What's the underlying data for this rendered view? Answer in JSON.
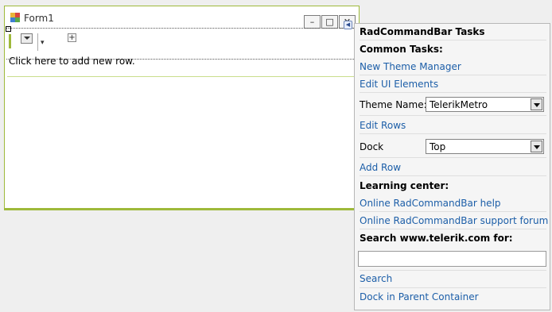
{
  "form": {
    "title": "Form1",
    "add_row_text": "Click here to add new row.",
    "overflow_glyph": "▾",
    "add_glyph": "+",
    "window_buttons": {
      "minimize": "–",
      "maximize": "□",
      "close": "✕"
    }
  },
  "smart_tag_glyph": "◀",
  "tasks_panel": {
    "title": "RadCommandBar Tasks",
    "common_tasks_label": "Common Tasks:",
    "links": {
      "new_theme_manager": "New Theme Manager",
      "edit_ui_elements": "Edit UI Elements",
      "edit_rows": "Edit Rows",
      "add_row": "Add Row"
    },
    "theme_name": {
      "label": "Theme Name:",
      "value": "TelerikMetro"
    },
    "dock": {
      "label": "Dock",
      "value": "Top"
    },
    "learning_center_label": "Learning center:",
    "learning_links": {
      "help": "Online RadCommandBar help",
      "forum": "Online RadCommandBar support forum"
    },
    "search_label": "Search www.telerik.com for:",
    "search_value": "",
    "search_link": "Search",
    "dock_parent_link": "Dock in Parent Container"
  },
  "colors": {
    "accent_green": "#9eb93a",
    "link_blue": "#1c5ea8"
  }
}
